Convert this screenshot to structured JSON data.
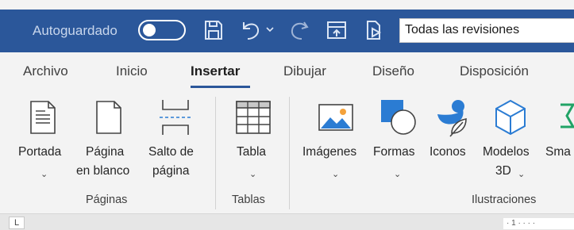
{
  "titlebar": {
    "autosave_label": "Autoguardado",
    "autosave_state": "off",
    "quick_access_icons": [
      "save-icon",
      "undo-icon",
      "undo-dropdown-icon",
      "redo-icon",
      "present-icon",
      "read-mode-icon"
    ],
    "revisions_value": "Todas las revisiones"
  },
  "tabs": [
    {
      "label": "Archivo"
    },
    {
      "label": "Inicio"
    },
    {
      "label": "Insertar",
      "active": true
    },
    {
      "label": "Dibujar"
    },
    {
      "label": "Diseño"
    },
    {
      "label": "Disposición"
    }
  ],
  "ribbon": {
    "commands": {
      "portada": "Portada",
      "pagina_line1": "Página",
      "pagina_line2": "en blanco",
      "salto_line1": "Salto de",
      "salto_line2": "página",
      "tabla": "Tabla",
      "imagenes": "Imágenes",
      "formas": "Formas",
      "iconos": "Iconos",
      "modelos_line1": "Modelos",
      "modelos_line2": "3D",
      "smartart": "Sma"
    },
    "groups": {
      "paginas": "Páginas",
      "tablas": "Tablas",
      "ilustraciones": "Ilustraciones"
    }
  },
  "ruler": {
    "corner": "L",
    "marks": "· 1 · · · ·"
  },
  "colors": {
    "titlebar": "#2b579a",
    "ribbon_bg": "#f3f3f3",
    "accent_green": "#21a366"
  }
}
